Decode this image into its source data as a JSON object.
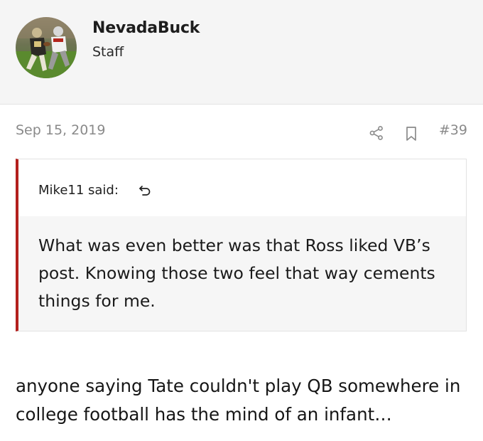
{
  "author": {
    "username": "NevadaBuck",
    "title": "Staff",
    "avatar_icon": "football-player-avatar"
  },
  "post": {
    "date": "Sep 15, 2019",
    "number": "#39",
    "share_icon": "share-icon",
    "bookmark_icon": "bookmark-icon"
  },
  "quote": {
    "author_line": "Mike11 said:",
    "jump_icon": "jump-to-quote-icon",
    "text": "What was even better was that Ross liked VB’s post. Knowing those two feel that way cements things for me."
  },
  "body": {
    "text": "anyone saying Tate couldn't play QB somewhere in college football has the mind of an infant…"
  },
  "colors": {
    "quote_accent": "#b3201d",
    "meta_gray": "#8a8a8a",
    "header_bg": "#f5f5f5"
  }
}
